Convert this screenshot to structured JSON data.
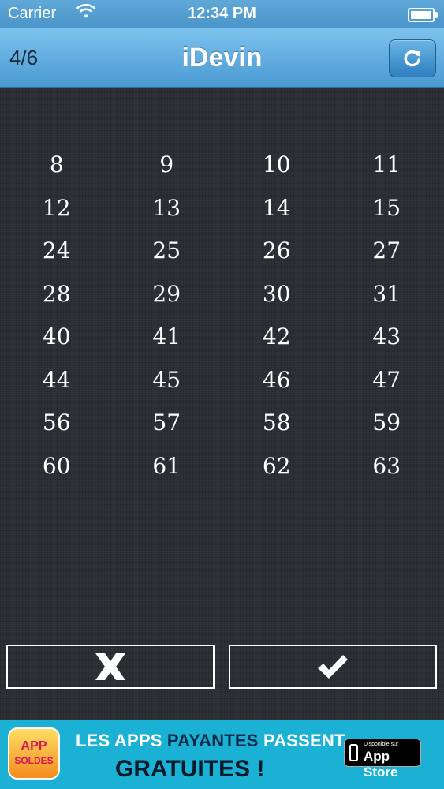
{
  "status_bar": {
    "carrier": "Carrier",
    "time": "12:34 PM"
  },
  "navbar": {
    "progress": "4/6",
    "title": "iDevin",
    "refresh_icon": "refresh-icon"
  },
  "numbers": [
    8,
    9,
    10,
    11,
    12,
    13,
    14,
    15,
    24,
    25,
    26,
    27,
    28,
    29,
    30,
    31,
    40,
    41,
    42,
    43,
    44,
    45,
    46,
    47,
    56,
    57,
    58,
    59,
    60,
    61,
    62,
    63
  ],
  "buttons": {
    "no_icon": "x-icon",
    "yes_icon": "check-icon"
  },
  "banner": {
    "logo_top": "APP",
    "logo_bottom": "SOLDES",
    "line1_before": "LES APPS ",
    "line1_highlight": "PAYANTES",
    "line1_after": " PASSENT",
    "line2": "GRATUITES !",
    "store_small": "Disponible sur",
    "store_big": "App Store"
  },
  "colors": {
    "nav_accent": "#4a9ad2",
    "banner_bg": "#1bb1d4"
  }
}
